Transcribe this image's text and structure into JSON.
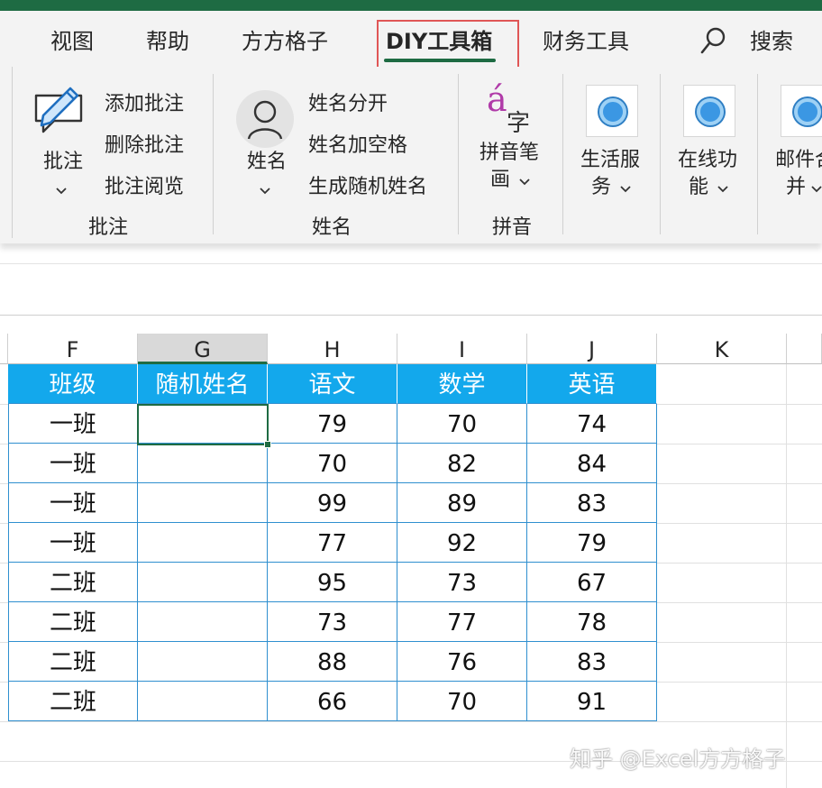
{
  "ribbon": {
    "tabs": [
      {
        "label": "视图",
        "active": false
      },
      {
        "label": "帮助",
        "active": false
      },
      {
        "label": "方方格子",
        "active": false
      },
      {
        "label": "DIY工具箱",
        "active": true
      },
      {
        "label": "财务工具",
        "active": false
      }
    ],
    "search_label": "搜索",
    "groups": {
      "comments": {
        "label": "批注",
        "big_button": "批注",
        "items": [
          "添加批注",
          "删除批注",
          "批注阅览"
        ]
      },
      "names": {
        "label": "姓名",
        "big_button": "姓名",
        "items": [
          "姓名分开",
          "姓名加空格",
          "生成随机姓名"
        ]
      },
      "pinyin": {
        "label": "拼音",
        "icon_glyph": "á",
        "icon_char": "字",
        "button_line1": "拼音笔",
        "button_line2": "画"
      },
      "services": [
        {
          "line1": "生活服",
          "line2": "务"
        },
        {
          "line1": "在线功",
          "line2": "能"
        },
        {
          "line1": "邮件合",
          "line2": "并"
        }
      ]
    }
  },
  "sheet": {
    "columns": [
      "F",
      "G",
      "H",
      "I",
      "J",
      "K"
    ],
    "selected_column": "G",
    "headers": [
      "班级",
      "随机姓名",
      "语文",
      "数学",
      "英语"
    ],
    "rows": [
      [
        "一班",
        "",
        "79",
        "70",
        "74"
      ],
      [
        "一班",
        "",
        "70",
        "82",
        "84"
      ],
      [
        "一班",
        "",
        "99",
        "89",
        "83"
      ],
      [
        "一班",
        "",
        "77",
        "92",
        "79"
      ],
      [
        "二班",
        "",
        "95",
        "73",
        "67"
      ],
      [
        "二班",
        "",
        "73",
        "77",
        "78"
      ],
      [
        "二班",
        "",
        "88",
        "76",
        "83"
      ],
      [
        "二班",
        "",
        "66",
        "70",
        "91"
      ]
    ]
  },
  "watermark": "知乎 @Excel方方格子",
  "colors": {
    "accent": "#1e6b43",
    "header_fill": "#13a8ec",
    "table_border": "#2f8fcf",
    "highlight_box": "#e05656"
  }
}
